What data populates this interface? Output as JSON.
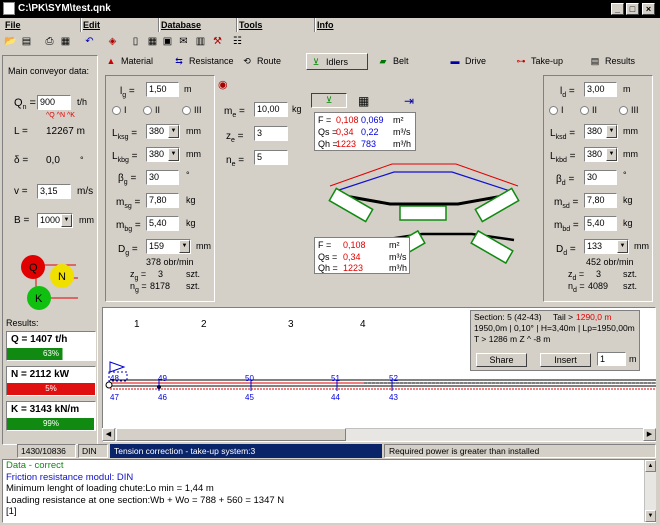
{
  "window": {
    "title": "C:\\PK\\SYM\\test.qnk"
  },
  "menu": [
    "File",
    "Edit",
    "Database",
    "Tools",
    "Info"
  ],
  "toolbar_icons": [
    "open-icon",
    "save-icon",
    "print-icon",
    "print-preview-icon",
    "undo-icon",
    "eraser-icon",
    "calculator-icon",
    "grid-icon",
    "picture-icon",
    "mail-icon",
    "database-icon",
    "tools-icon",
    "settings-icon"
  ],
  "tabs": [
    {
      "label": "Material",
      "icon": "material-icon"
    },
    {
      "label": "Resistance",
      "icon": "resistance-icon"
    },
    {
      "label": "Route",
      "icon": "route-icon"
    },
    {
      "label": "Idlers",
      "icon": "idlers-icon"
    },
    {
      "label": "Belt",
      "icon": "belt-icon"
    },
    {
      "label": "Drive",
      "icon": "drive-icon"
    },
    {
      "label": "Take-up",
      "icon": "takeup-icon"
    },
    {
      "label": "Results",
      "icon": "results-icon"
    }
  ],
  "left": {
    "heading": "Main conveyor data:",
    "Q_label": "Q",
    "Q_sub": "n",
    "Q_value": "900",
    "Q_unit": "t/h",
    "Q_hints": "^Q  ^N  ^K",
    "L_label": "L",
    "L_value": "12267 m",
    "delta_label": "δ",
    "delta_value": "0,0",
    "delta_unit": "°",
    "v_label": "v",
    "v_value": "3,15",
    "v_unit": "m/s",
    "B_label": "B",
    "B_value": "1000",
    "B_unit": "mm",
    "indicators": [
      "Q",
      "N",
      "K"
    ],
    "results_heading": "Results:",
    "results": [
      {
        "text": "Q = 1407 t/h",
        "pct": "63%",
        "fraction": 0.63,
        "color": "#108a10"
      },
      {
        "text": "N = 2112 kW",
        "pct": "5%",
        "fraction": 0.05,
        "color": "#e01010"
      },
      {
        "text": "K = 3143 kN/m",
        "pct": "99%",
        "fraction": 0.99,
        "color": "#108a10"
      }
    ]
  },
  "upper_idler": {
    "lg_value": "1,50",
    "lg_unit": "m",
    "radios": [
      "I",
      "II",
      "III"
    ],
    "lksg_value": "380",
    "lksg_unit": "mm",
    "lkbg_value": "380",
    "lkbg_unit": "mm",
    "beta_value": "30",
    "beta_unit": "°",
    "msg_value": "7,80",
    "msg_unit": "kg",
    "mbg_value": "5,40",
    "mbg_unit": "kg",
    "dg_value": "159",
    "dg_unit": "mm",
    "rpm": "378 obr/min",
    "zg_value": "3",
    "ng_value": "8178",
    "szt": "szt."
  },
  "center": {
    "me_value": "10,00",
    "me_unit": "kg",
    "ze_value": "3",
    "ne_value": "5",
    "upper_table": {
      "F": "0,108",
      "F2": "0,069",
      "F_unit": "m²",
      "Qs": "0,34",
      "Qs2": "0,22",
      "Qs_unit": "m³/s",
      "Qh": "1223",
      "Qh2": "783",
      "Qh_unit": "m³/h"
    },
    "lower_table": {
      "F": "0,108",
      "F_unit": "m²",
      "Qs": "0,34",
      "Qs_unit": "m³/s",
      "Qh": "1223",
      "Qh_unit": "m³/h"
    }
  },
  "lower_idler": {
    "ld_value": "3,00",
    "ld_unit": "m",
    "radios": [
      "I",
      "II",
      "III"
    ],
    "lksd_value": "380",
    "lksd_unit": "mm",
    "lkbd_value": "380",
    "lkbd_unit": "mm",
    "beta_value": "30",
    "beta_unit": "°",
    "msd_value": "7,80",
    "msd_unit": "kg",
    "mbd_value": "5,40",
    "mbd_unit": "kg",
    "dd_value": "133",
    "dd_unit": "mm",
    "rpm": "452 obr/min",
    "zd_value": "3",
    "nd_value": "4089",
    "szt": "szt."
  },
  "route": {
    "sections": [
      "1",
      "2",
      "3",
      "4"
    ],
    "upper_nodes": [
      "48",
      "49",
      "50",
      "51",
      "52"
    ],
    "lower_nodes": [
      "47",
      "46",
      "45",
      "44",
      "43"
    ],
    "info_line1": "Section: 5  (42-43)",
    "tail_label": "Tail >",
    "tail_value": "1290,0 m",
    "info_line2": "1950,0m | 0,10° | H=3,40m | Lp=1950,00m",
    "info_line3": "T > 1286 m   Z ^ -8 m",
    "share_label": "Share",
    "insert_label": "Insert",
    "insert_value": "1",
    "insert_unit": "m"
  },
  "status": {
    "length": "1430/10836 m",
    "method": "DIN",
    "tension": "Tension correction - take-up system:3",
    "warning": "Required power is greater than installed"
  },
  "log": [
    {
      "text": "Data - correct",
      "color": "#108a10"
    },
    {
      "text": "Friction resistance modul: DIN",
      "color": "#1010c8"
    },
    {
      "text": "Minimum lenght of loading chute:Lo min = 1,44 m",
      "color": "#000000"
    },
    {
      "text": "Loading resistance at one section:Wb + Wo = 788 + 560 = 1347 N",
      "color": "#000000"
    },
    {
      "text": "[1]",
      "color": "#000000"
    }
  ]
}
